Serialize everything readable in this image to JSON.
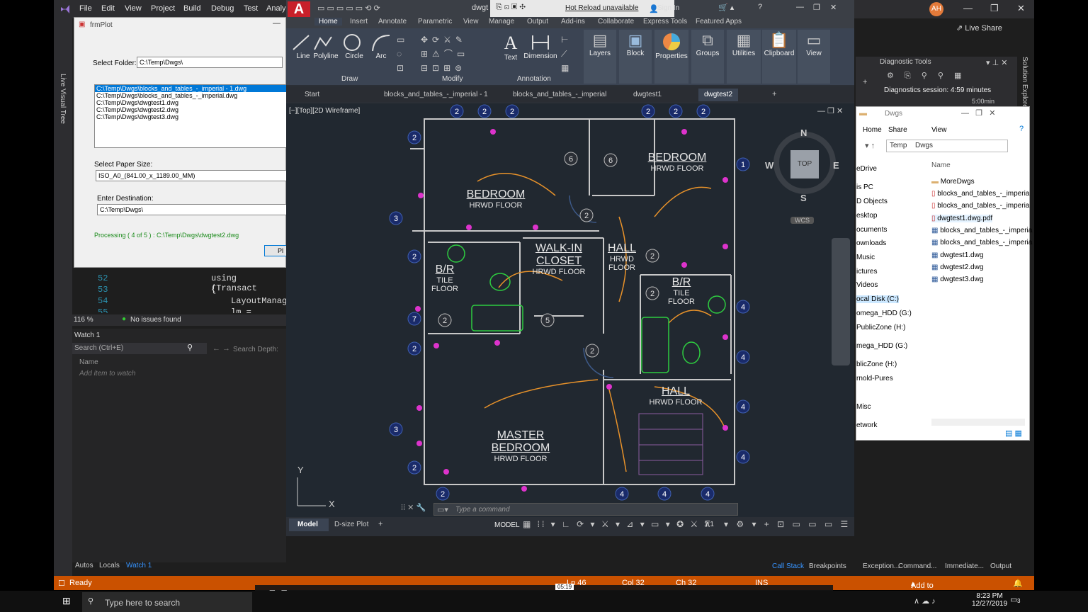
{
  "vs": {
    "menu": [
      "File",
      "Edit",
      "View",
      "Project",
      "Build",
      "Debug",
      "Test",
      "Analy"
    ],
    "avatar": "AH",
    "live_share": "Live Share",
    "left_rail": "Live Visual Tree",
    "zoom": "116 %",
    "issues": "No issues found",
    "code_lines": [
      {
        "n": "52",
        "t": "using (Transact"
      },
      {
        "n": "53",
        "t": "{"
      },
      {
        "n": "54",
        "t": "LayoutManag"
      },
      {
        "n": "55",
        "t": "lm = Layout"
      }
    ],
    "watch": {
      "title": "Watch 1",
      "search_placeholder": "Search (Ctrl+E)",
      "search_depth": "Search Depth:",
      "col_name": "Name",
      "add_item": "Add item to watch"
    },
    "bottom_left_tabs": [
      "Autos",
      "Locals",
      "Watch 1"
    ],
    "bottom_right_tabs": [
      "Call Stack",
      "Breakpoints",
      "Exception...",
      "Command...",
      "Immediate...",
      "Output"
    ],
    "status": {
      "ready": "Ready",
      "ln": "Ln 46",
      "col": "Col 32",
      "ch": "Ch 32",
      "ins": "INS",
      "source_control": "Add to Source Control"
    },
    "solution_explorer": "Solution Explorer"
  },
  "frm": {
    "title": "frmPlot",
    "folder_label": "Select Folder:",
    "folder_value": "C:\\Temp\\Dwgs\\",
    "files": [
      "C:\\Temp\\Dwgs\\blocks_and_tables_-_imperial - 1.dwg",
      "C:\\Temp\\Dwgs\\blocks_and_tables_-_imperial.dwg",
      "C:\\Temp\\Dwgs\\dwgtest1.dwg",
      "C:\\Temp\\Dwgs\\dwgtest2.dwg",
      "C:\\Temp\\Dwgs\\dwgtest3.dwg"
    ],
    "paper_label": "Select Paper Size:",
    "paper_value": "ISO_A0_(841.00_x_1189.00_MM)",
    "dest_label": "Enter Destination:",
    "dest_value": "C:\\Temp\\Dwgs\\",
    "processing": "Processing ( 4 of 5 ) : C:\\Temp\\Dwgs\\dwgtest2.dwg",
    "button": "Pl"
  },
  "acad": {
    "logo": "A",
    "title_file": "dwgt",
    "hot_reload": "Hot Reload unavailable",
    "sign_in": "Sign In",
    "ribbon_tabs": [
      "Home",
      "Insert",
      "Annotate",
      "Parametric",
      "View",
      "Manage",
      "Output",
      "Add-ins",
      "Collaborate",
      "Express Tools",
      "Featured Apps"
    ],
    "draw_tools": [
      "Line",
      "Polyline",
      "Circle",
      "Arc"
    ],
    "annotation_tools": [
      "Text",
      "Dimension"
    ],
    "big_tools": [
      "Layers",
      "Block",
      "Properties",
      "Groups",
      "Utilities",
      "Clipboard",
      "View"
    ],
    "panels": [
      "Draw",
      "Modify",
      "Annotation"
    ],
    "doc_tabs": [
      "Start",
      "blocks_and_tables_-_imperial - 1",
      "blocks_and_tables_-_imperial",
      "dwgtest1",
      "dwgtest2"
    ],
    "viewport_label": "[−][Top][2D Wireframe]",
    "viewcube": {
      "top": "TOP",
      "n": "N",
      "s": "S",
      "e": "E",
      "w": "W",
      "wcs": "WCS"
    },
    "rooms": [
      {
        "name": "BEDROOM",
        "sub": "HRWD FLOOR"
      },
      {
        "name": "BEDROOM",
        "sub": "HRWD FLOOR"
      },
      {
        "name": "WALK-IN",
        "name2": "CLOSET",
        "sub": "HRWD FLOOR"
      },
      {
        "name": "HALL",
        "sub": "HRWD",
        "sub2": "FLOOR"
      },
      {
        "name": "B/R",
        "sub": "TILE",
        "sub2": "FLOOR"
      },
      {
        "name": "B/R",
        "sub": "TILE",
        "sub2": "FLOOR"
      },
      {
        "name": "HALL",
        "sub": "HRWD FLOOR"
      },
      {
        "name": "MASTER",
        "name2": "BEDROOM",
        "sub": "HRWD FLOOR"
      }
    ],
    "cmd_placeholder": "Type a command",
    "layout_tabs": [
      "Model",
      "D-size Plot"
    ],
    "status_model": "MODEL",
    "scale": "1:1",
    "axis_x": "X",
    "axis_y": "Y"
  },
  "diag": {
    "title": "Diagnostic Tools",
    "session": "Diagnostics session: 4:59 minutes",
    "val": "5:00min"
  },
  "explorer": {
    "title": "Dwgs",
    "ribbon": [
      "Home",
      "Share",
      "View"
    ],
    "path": [
      "Temp",
      "Dwgs"
    ],
    "nav": [
      "eDrive",
      "is PC",
      "D Objects",
      "esktop",
      "ocuments",
      "ownloads",
      "Music",
      "ictures",
      "Videos",
      "ocal Disk (C:)",
      "omega_HDD (G:)",
      "PublicZone (H:)",
      "mega_HDD (G:)",
      "blicZone (H:)",
      "rnold-Pures",
      "Misc",
      "etwork"
    ],
    "col_name": "Name",
    "files": [
      "MoreDwgs",
      "blocks_and_tables_-_imperia",
      "blocks_and_tables_-_imperia",
      "dwgtest1.dwg.pdf",
      "blocks_and_tables_-_imperia",
      "blocks_and_tables_-_imperia",
      "dwgtest1.dwg",
      "dwgtest2.dwg",
      "dwgtest3.dwg"
    ]
  },
  "player": {
    "time": "05:19"
  },
  "taskbar": {
    "search": "Type here to search",
    "time": "8:23 PM",
    "date": "12/27/2019",
    "notif": "3"
  }
}
